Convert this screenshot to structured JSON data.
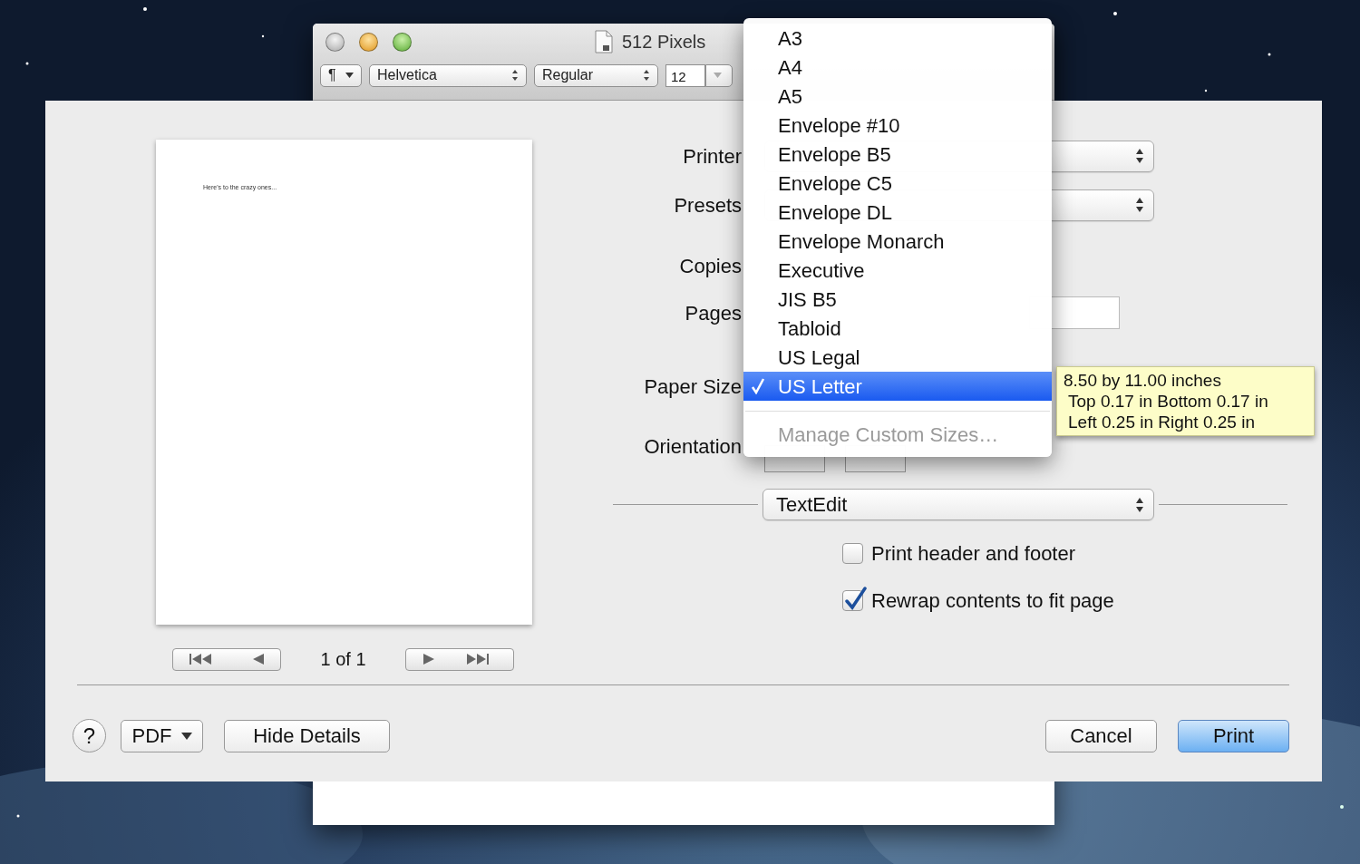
{
  "window": {
    "title": "512 Pixels"
  },
  "toolbar": {
    "paragraph_menu": "¶",
    "font_family": "Helvetica",
    "font_style": "Regular",
    "font_size": "12"
  },
  "preview": {
    "page_text": "Here's to the crazy ones...",
    "page_indicator": "1 of 1"
  },
  "settings": [
    {
      "label": "Printer",
      "kind": "popup"
    },
    {
      "label": "Presets",
      "kind": "popup"
    },
    {
      "label": "Copies",
      "kind": "none"
    },
    {
      "label": "Pages",
      "kind": "range"
    },
    {
      "label": "Paper Size",
      "kind": "none"
    },
    {
      "label": "Orientation",
      "kind": "orientation"
    }
  ],
  "app_panel": {
    "selected": "TextEdit"
  },
  "options": [
    {
      "label": "Print header and footer",
      "checked": false
    },
    {
      "label": "Rewrap contents to fit page",
      "checked": true
    }
  ],
  "footer": {
    "help": "?",
    "pdf": "PDF",
    "hide_details": "Hide Details",
    "cancel": "Cancel",
    "print": "Print"
  },
  "paper_menu": {
    "items": [
      {
        "label": "A3",
        "selected": false
      },
      {
        "label": "A4",
        "selected": false
      },
      {
        "label": "A5",
        "selected": false
      },
      {
        "label": "Envelope #10",
        "selected": false
      },
      {
        "label": "Envelope B5",
        "selected": false
      },
      {
        "label": "Envelope C5",
        "selected": false
      },
      {
        "label": "Envelope DL",
        "selected": false
      },
      {
        "label": "Envelope Monarch",
        "selected": false
      },
      {
        "label": "Executive",
        "selected": false
      },
      {
        "label": "JIS B5",
        "selected": false
      },
      {
        "label": "Tabloid",
        "selected": false
      },
      {
        "label": "US Legal",
        "selected": false
      },
      {
        "label": "US Letter",
        "selected": true
      }
    ],
    "manage": {
      "label": "Manage Custom Sizes…",
      "disabled": true
    }
  },
  "tooltip": {
    "lines": [
      "8.50 by 11.00 inches",
      "Top 0.17 in Bottom 0.17 in",
      "Left 0.25 in Right 0.25 in"
    ]
  }
}
